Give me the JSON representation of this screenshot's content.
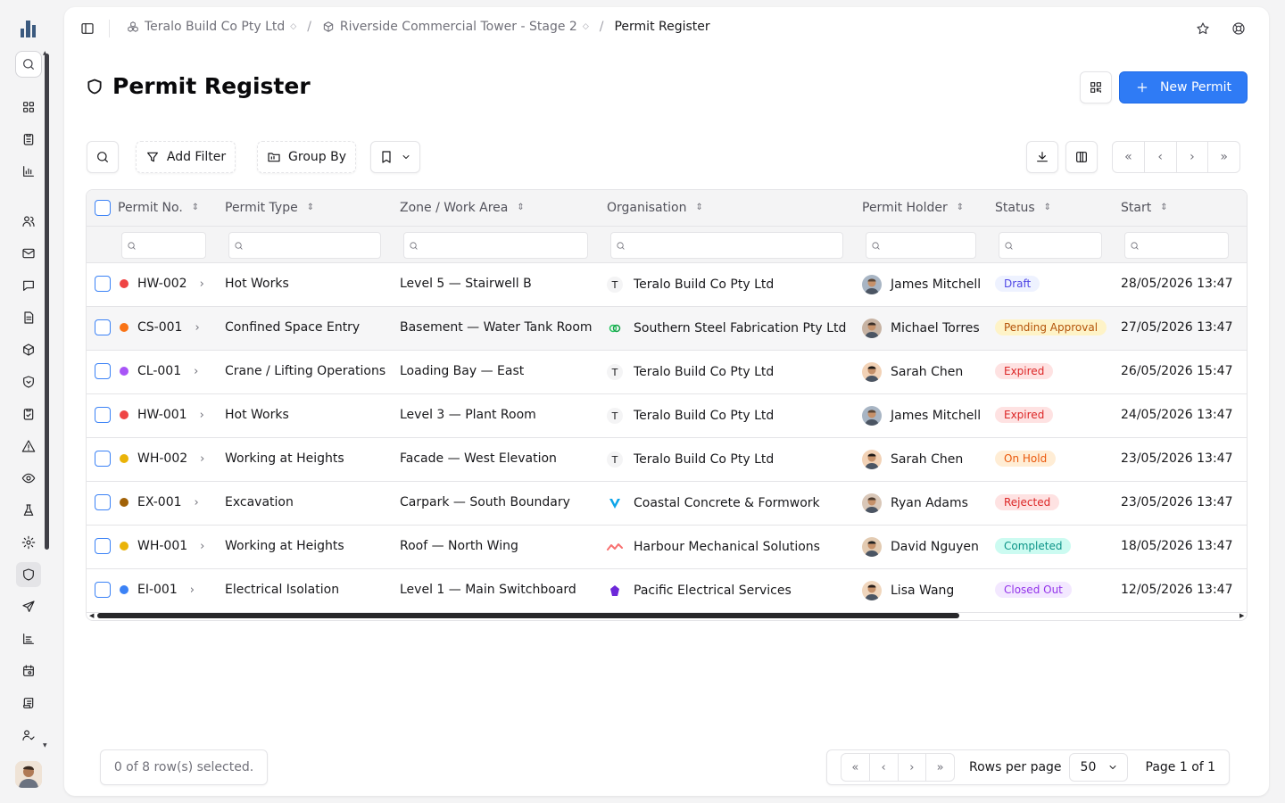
{
  "sidebar": {
    "icons": [
      "logo-icon",
      "search-icon",
      "dashboard-icon",
      "clipboard-icon",
      "chart-icon",
      "users-icon",
      "mail-icon",
      "chat-icon",
      "document-icon",
      "box-icon",
      "shield-heart-icon",
      "clipboard-check-icon",
      "warning-icon",
      "eye-icon",
      "flask-icon",
      "gear-icon",
      "shield-icon",
      "send-icon",
      "report-icon",
      "calendar-icon",
      "scroll-icon",
      "user-check-icon"
    ]
  },
  "breadcrumb": {
    "company": "Teralo Build Co Pty Ltd",
    "project": "Riverside Commercial Tower - Stage 2",
    "current": "Permit Register"
  },
  "header": {
    "title": "Permit Register",
    "new_button": "New Permit"
  },
  "toolbar": {
    "add_filter": "Add Filter",
    "group_by": "Group By"
  },
  "table": {
    "columns": [
      "Permit No.",
      "Permit Type",
      "Zone / Work Area",
      "Organisation",
      "Permit Holder",
      "Status",
      "Start"
    ],
    "rows": [
      {
        "no": "HW-002",
        "dot": "#ef4444",
        "type": "Hot Works",
        "zone": "Level 5 — Stairwell B",
        "org": "Teralo Build Co Pty Ltd",
        "org_logo": "T",
        "holder": "James Mitchell",
        "status": "Draft",
        "start": "28/05/2026 13:47"
      },
      {
        "no": "CS-001",
        "dot": "#f97316",
        "type": "Confined Space Entry",
        "zone": "Basement — Water Tank Room",
        "org": "Southern Steel Fabrication Pty Ltd",
        "org_logo": "",
        "holder": "Michael Torres",
        "status": "Pending Approval",
        "start": "27/05/2026 13:47"
      },
      {
        "no": "CL-001",
        "dot": "#a855f7",
        "type": "Crane / Lifting Operations",
        "zone": "Loading Bay — East",
        "org": "Teralo Build Co Pty Ltd",
        "org_logo": "T",
        "holder": "Sarah Chen",
        "status": "Expired",
        "start": "26/05/2026 15:47"
      },
      {
        "no": "HW-001",
        "dot": "#ef4444",
        "type": "Hot Works",
        "zone": "Level 3 — Plant Room",
        "org": "Teralo Build Co Pty Ltd",
        "org_logo": "T",
        "holder": "James Mitchell",
        "status": "Expired",
        "start": "24/05/2026 13:47"
      },
      {
        "no": "WH-002",
        "dot": "#eab308",
        "type": "Working at Heights",
        "zone": "Facade — West Elevation",
        "org": "Teralo Build Co Pty Ltd",
        "org_logo": "T",
        "holder": "Sarah Chen",
        "status": "On Hold",
        "start": "23/05/2026 13:47"
      },
      {
        "no": "EX-001",
        "dot": "#a16207",
        "type": "Excavation",
        "zone": "Carpark — South Boundary",
        "org": "Coastal Concrete & Formwork",
        "org_logo": "",
        "holder": "Ryan Adams",
        "status": "Rejected",
        "start": "23/05/2026 13:47"
      },
      {
        "no": "WH-001",
        "dot": "#eab308",
        "type": "Working at Heights",
        "zone": "Roof — North Wing",
        "org": "Harbour Mechanical Solutions",
        "org_logo": "",
        "holder": "David Nguyen",
        "status": "Completed",
        "start": "18/05/2026 13:47"
      },
      {
        "no": "EI-001",
        "dot": "#3b82f6",
        "type": "Electrical Isolation",
        "zone": "Level 1 — Main Switchboard",
        "org": "Pacific Electrical Services",
        "org_logo": "",
        "holder": "Lisa Wang",
        "status": "Closed Out",
        "start": "12/05/2026 13:47"
      }
    ]
  },
  "status_colors": {
    "Draft": {
      "bg": "#eef2ff",
      "fg": "#4f46e5"
    },
    "Pending Approval": {
      "bg": "#fef3c7",
      "fg": "#b45309"
    },
    "Expired": {
      "bg": "#fee2e2",
      "fg": "#dc2626"
    },
    "On Hold": {
      "bg": "#ffedd5",
      "fg": "#ea580c"
    },
    "Rejected": {
      "bg": "#fee2e2",
      "fg": "#dc2626"
    },
    "Completed": {
      "bg": "#ccfbf1",
      "fg": "#0d9488"
    },
    "Closed Out": {
      "bg": "#f3e8ff",
      "fg": "#9333ea"
    }
  },
  "footer": {
    "selected": "0 of 8 row(s) selected.",
    "rows_per_page_label": "Rows per page",
    "rows_per_page": "50",
    "page_info": "Page 1 of 1"
  },
  "colors": {
    "accent": "#2f7bf5"
  }
}
